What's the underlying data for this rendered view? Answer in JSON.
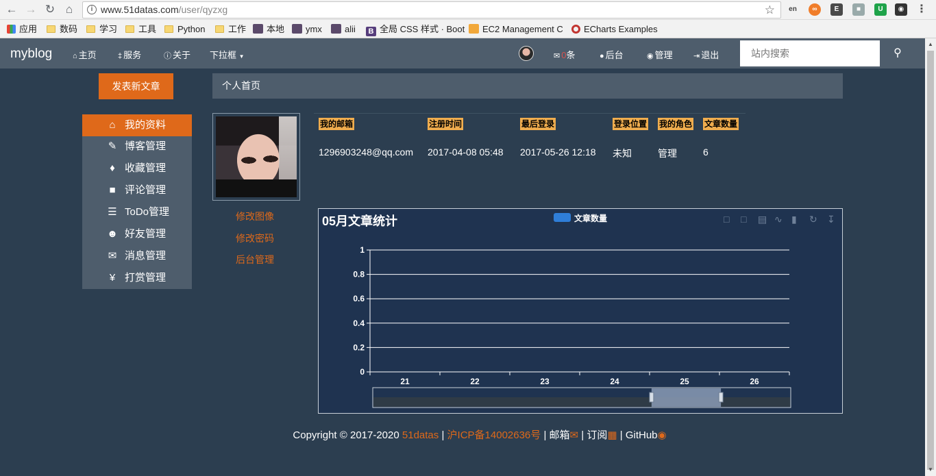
{
  "browser": {
    "url_host": "www.51datas.com",
    "url_path": "/user/qyzxg",
    "bookmarks": [
      "应用",
      "数码",
      "学习",
      "工具",
      "Python",
      "工作",
      "本地",
      "ymx",
      "alii",
      "全局 CSS 样式 · Boot",
      "EC2 Management C",
      "ECharts Examples"
    ]
  },
  "navbar": {
    "brand": "myblog",
    "home": "主页",
    "services": "服务",
    "about": "关于",
    "dropdown": "下拉框",
    "msg_count": "0",
    "msg_unit": "条",
    "backend": "后台",
    "manage": "管理",
    "logout": "退出",
    "search_placeholder": "站内搜索"
  },
  "publish_button": "发表新文章",
  "panel_title": "个人首页",
  "side_menu": [
    {
      "icon": "home-icon",
      "label": "我的资料",
      "active": true
    },
    {
      "icon": "pencil-icon",
      "label": "博客管理"
    },
    {
      "icon": "tags-icon",
      "label": "收藏管理"
    },
    {
      "icon": "comment-icon",
      "label": "评论管理"
    },
    {
      "icon": "tasks-icon",
      "label": "ToDo管理"
    },
    {
      "icon": "user-icon",
      "label": "好友管理"
    },
    {
      "icon": "envelope-icon",
      "label": "消息管理"
    },
    {
      "icon": "yen-icon",
      "label": "打赏管理"
    }
  ],
  "profile_links": [
    "修改图像",
    "修改密码",
    "后台管理"
  ],
  "info_table": {
    "headers": [
      "我的邮箱",
      "注册时间",
      "最后登录",
      "登录位置",
      "我的角色",
      "文章数量"
    ],
    "values": [
      "1296903248@qq.com",
      "2017-04-08 05:48",
      "2017-05-26 12:18",
      "未知",
      "管理",
      "6"
    ]
  },
  "colors": {
    "accent": "#df691a",
    "page_bg": "#2c3e50",
    "navbar_bg": "#4e5d6c",
    "chart_bg": "#1f3350",
    "series": "#2f7ed8",
    "header_badge": "#f0ad4e"
  },
  "chart_data": {
    "type": "bar",
    "title": "05月文章统计",
    "categories": [
      "21",
      "22",
      "23",
      "24",
      "25",
      "26"
    ],
    "series": [
      {
        "name": "文章数量",
        "values": [
          0,
          0,
          0,
          0,
          0,
          0
        ]
      }
    ],
    "ylim": [
      0,
      1
    ],
    "yticks": [
      "0",
      "0.2",
      "0.4",
      "0.6",
      "0.8",
      "1"
    ],
    "grid": true,
    "legend": "top-center",
    "datazoom": {
      "start": 0.667,
      "end": 0.833
    }
  },
  "footer": {
    "copyright": "Copyright © 2017-2020",
    "site": "51datas",
    "sep1": "|",
    "icp": "沪ICP备14002636号",
    "sep2": "|",
    "mail": "邮箱",
    "sep3": "|",
    "subscribe": "订阅",
    "sep4": "|",
    "github": "GitHub"
  }
}
